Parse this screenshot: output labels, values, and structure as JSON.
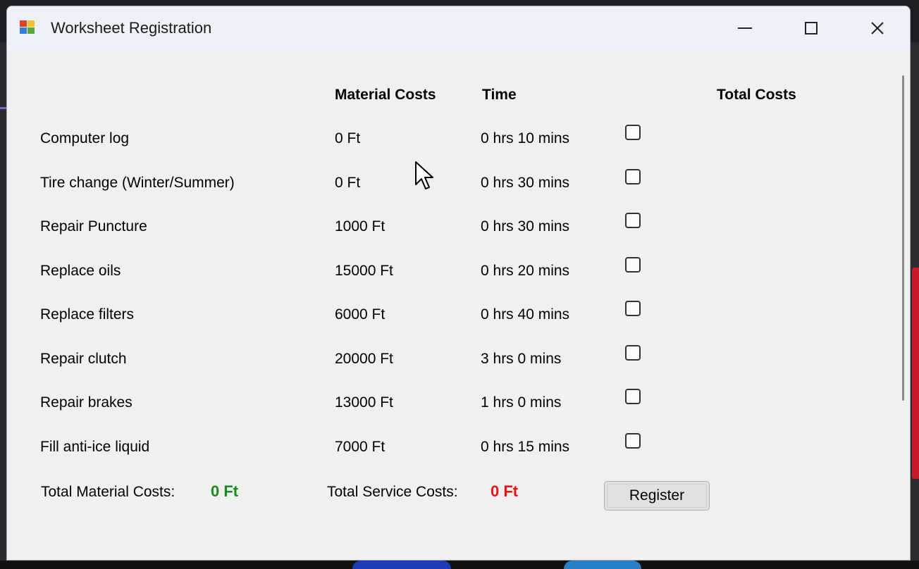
{
  "window": {
    "title": "Worksheet Registration",
    "icon": "app-form-icon"
  },
  "headers": {
    "material_costs": "Material Costs",
    "time": "Time",
    "total_costs": "Total Costs"
  },
  "services": [
    {
      "name": "Computer log",
      "material_cost": "0 Ft",
      "time": "0 hrs 10 mins",
      "checked": false
    },
    {
      "name": "Tire change (Winter/Summer)",
      "material_cost": "0 Ft",
      "time": "0 hrs 30 mins",
      "checked": false
    },
    {
      "name": "Repair Puncture",
      "material_cost": "1000 Ft",
      "time": "0 hrs 30 mins",
      "checked": false
    },
    {
      "name": "Replace oils",
      "material_cost": "15000 Ft",
      "time": "0 hrs 20 mins",
      "checked": false
    },
    {
      "name": "Replace filters",
      "material_cost": "6000 Ft",
      "time": "0 hrs 40 mins",
      "checked": false
    },
    {
      "name": "Repair clutch",
      "material_cost": "20000 Ft",
      "time": "3 hrs 0 mins",
      "checked": false
    },
    {
      "name": "Repair brakes",
      "material_cost": "13000 Ft",
      "time": "1 hrs 0 mins",
      "checked": false
    },
    {
      "name": "Fill anti-ice liquid",
      "material_cost": "7000 Ft",
      "time": "0 hrs 15 mins",
      "checked": false
    }
  ],
  "footer": {
    "total_material_label": "Total Material Costs:",
    "total_material_value": "0 Ft",
    "total_service_label": "Total Service Costs:",
    "total_service_value": "0 Ft",
    "register_label": "Register"
  },
  "colors": {
    "material_total": "#1a8a1a",
    "service_total": "#f01010"
  }
}
